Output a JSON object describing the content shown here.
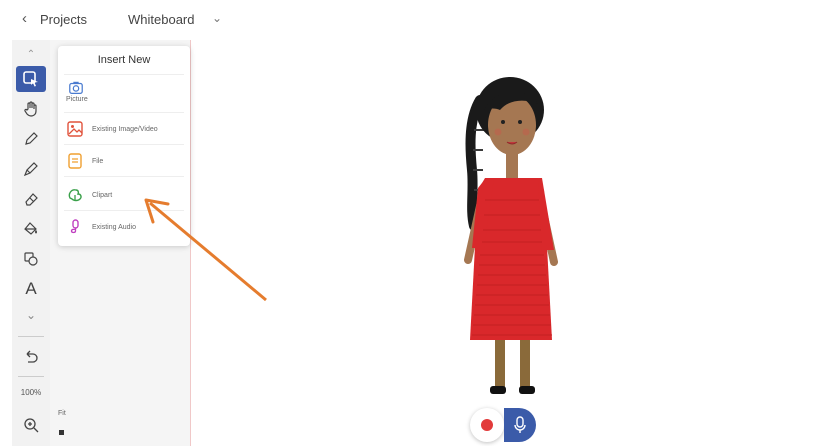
{
  "topbar": {
    "back_icon": "chevron-left-icon",
    "projects_label": "Projects",
    "title": "Whiteboard",
    "title_caret": "⌄"
  },
  "toolbar": {
    "tools": [
      {
        "name": "insert-tool",
        "icon": "insert-icon",
        "active": true
      },
      {
        "name": "hand-tool",
        "icon": "hand-icon"
      },
      {
        "name": "pen-tool",
        "icon": "pen-icon"
      },
      {
        "name": "marker-tool",
        "icon": "marker-icon"
      },
      {
        "name": "eraser-tool",
        "icon": "eraser-icon"
      },
      {
        "name": "fill-tool",
        "icon": "fill-icon"
      },
      {
        "name": "shapes-tool",
        "icon": "shapes-icon"
      },
      {
        "name": "text-tool",
        "icon": "text-icon",
        "glyph": "A"
      },
      {
        "name": "more-tools",
        "icon": "chevron-down-icon",
        "glyph": "⌄"
      }
    ],
    "undo_icon": "undo-icon",
    "zoom_label": "100%",
    "zoom_icon": "zoom-icon",
    "fit_label": "Fit"
  },
  "insert_popup": {
    "heading": "Insert New",
    "items": [
      {
        "label": "Picture",
        "icon": "camera-icon",
        "color": "#4a7bd0"
      },
      {
        "label": "Existing Image/Video",
        "icon": "image-video-icon",
        "color": "#e0533c"
      },
      {
        "label": "File",
        "icon": "file-icon",
        "color": "#f0a030"
      },
      {
        "label": "Clipart",
        "icon": "clipart-icon",
        "color": "#3aa04a"
      },
      {
        "label": "Existing Audio",
        "icon": "audio-icon",
        "color": "#c040c0"
      }
    ]
  },
  "colors": {
    "accent": "#3b5ba9",
    "record": "#e23a3a",
    "arrow": "#e57c2e",
    "dress": "#d9282b"
  },
  "canvas": {
    "figure": "girl-in-red-dress-clipart"
  },
  "record_controls": {
    "record_icon": "record-icon",
    "mic_icon": "microphone-icon"
  }
}
